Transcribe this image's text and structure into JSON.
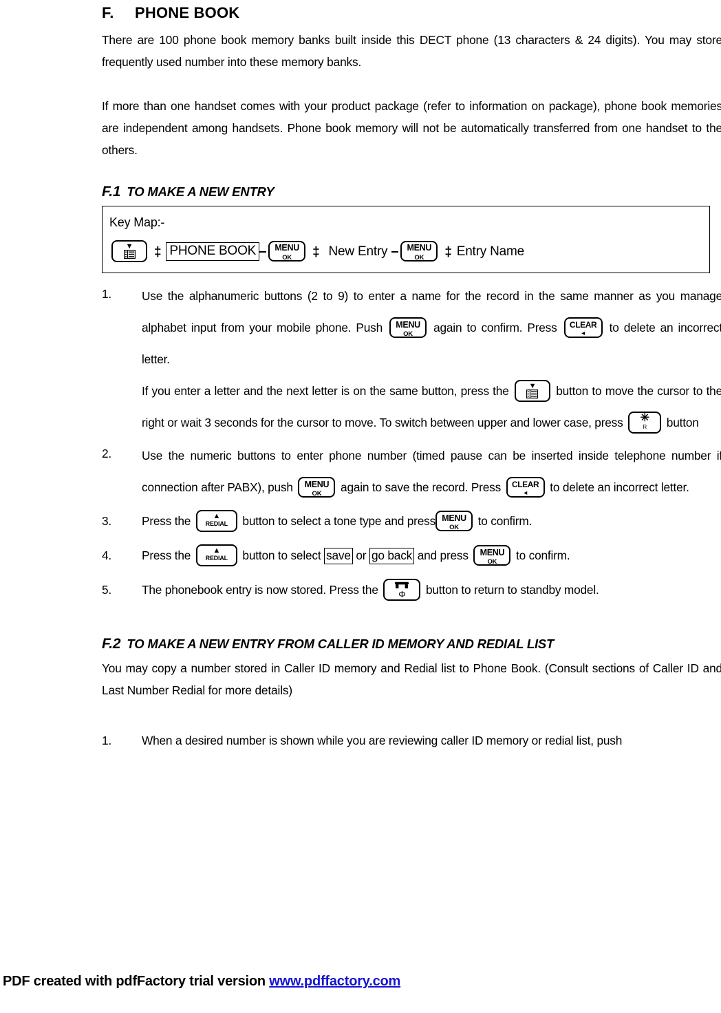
{
  "document": {
    "section": {
      "letter": "F.",
      "title": "PHONE BOOK"
    },
    "intro_paragraph_1": "There are 100 phone book memory banks built inside this DECT phone (13 characters & 24 digits). You may store frequently used number into these memory banks.",
    "intro_paragraph_2": "If more than one handset comes with your product package (refer to information on package), phone book memories are independent among handsets. Phone book memory will not be automatically transferred from one handset to the others."
  },
  "subsection_f1": {
    "number": "F.1",
    "title": "TO MAKE A NEW ENTRY",
    "keymap": {
      "label": "Key Map:-",
      "arrow": "‡",
      "step_phone_book": "PHONE BOOK",
      "step_new_entry": "New Entry",
      "step_entry_name": "Entry Name"
    },
    "steps": [
      {
        "marker": "1.",
        "text_a": "Use the alphanumeric buttons (2 to 9) to enter a name for the record in the same manner as you manage alphabet input from your mobile phone. Push",
        "text_b": "again to confirm. Press",
        "text_c": "to delete an incorrect letter.",
        "text_d": "If you enter a letter and the next letter is on the same button, press the",
        "text_e": "button to move the cursor to the right or wait 3 seconds for the cursor to move. To switch between upper and lower case, press",
        "text_f": "button"
      },
      {
        "marker": "2.",
        "text_a": "Use the numeric buttons to enter phone number (timed pause can be inserted inside telephone number if connection after PABX), push",
        "text_b": "again to save the record. Press",
        "text_c": "to delete an incorrect letter."
      },
      {
        "marker": "3.",
        "text_a": "Press the",
        "text_b": "button to select a tone type and press",
        "text_c": "to confirm."
      },
      {
        "marker": "4.",
        "text_a": "Press the",
        "text_b": "button to select",
        "option_save": "save",
        "text_c": "or",
        "option_go_back": "go back",
        "text_d": "and press",
        "text_e": "to confirm."
      },
      {
        "marker": "5.",
        "text_a": "The phonebook entry is now stored. Press the",
        "text_b": "button to return to standby model."
      }
    ]
  },
  "subsection_f2": {
    "number": "F.2",
    "title": "TO MAKE A NEW ENTRY FROM CALLER ID MEMORY AND REDIAL LIST",
    "paragraph": "You may copy a number stored in Caller ID memory and Redial list to Phone Book. (Consult sections of Caller ID and Last Number Redial for more details)",
    "steps": [
      {
        "marker": "1.",
        "text_a": "When a desired number is shown while you are reviewing caller ID memory or redial list, push"
      }
    ]
  },
  "keys": {
    "menu": {
      "top": "MENU",
      "bottom": "OK"
    },
    "clear": {
      "top": "CLEAR",
      "bottom": "◂"
    },
    "phonebook": {
      "top": "▼",
      "bottom": "☷"
    },
    "redial": {
      "top": "▲",
      "bottom": "REDIAL"
    },
    "star": {
      "top": "✳",
      "bottom": "R"
    },
    "end_call": {
      "bottom": "Φ"
    }
  },
  "footer": {
    "text": "PDF created with pdfFactory trial version ",
    "link_text": "www.pdffactory.com",
    "link_color": "#1414d2"
  }
}
